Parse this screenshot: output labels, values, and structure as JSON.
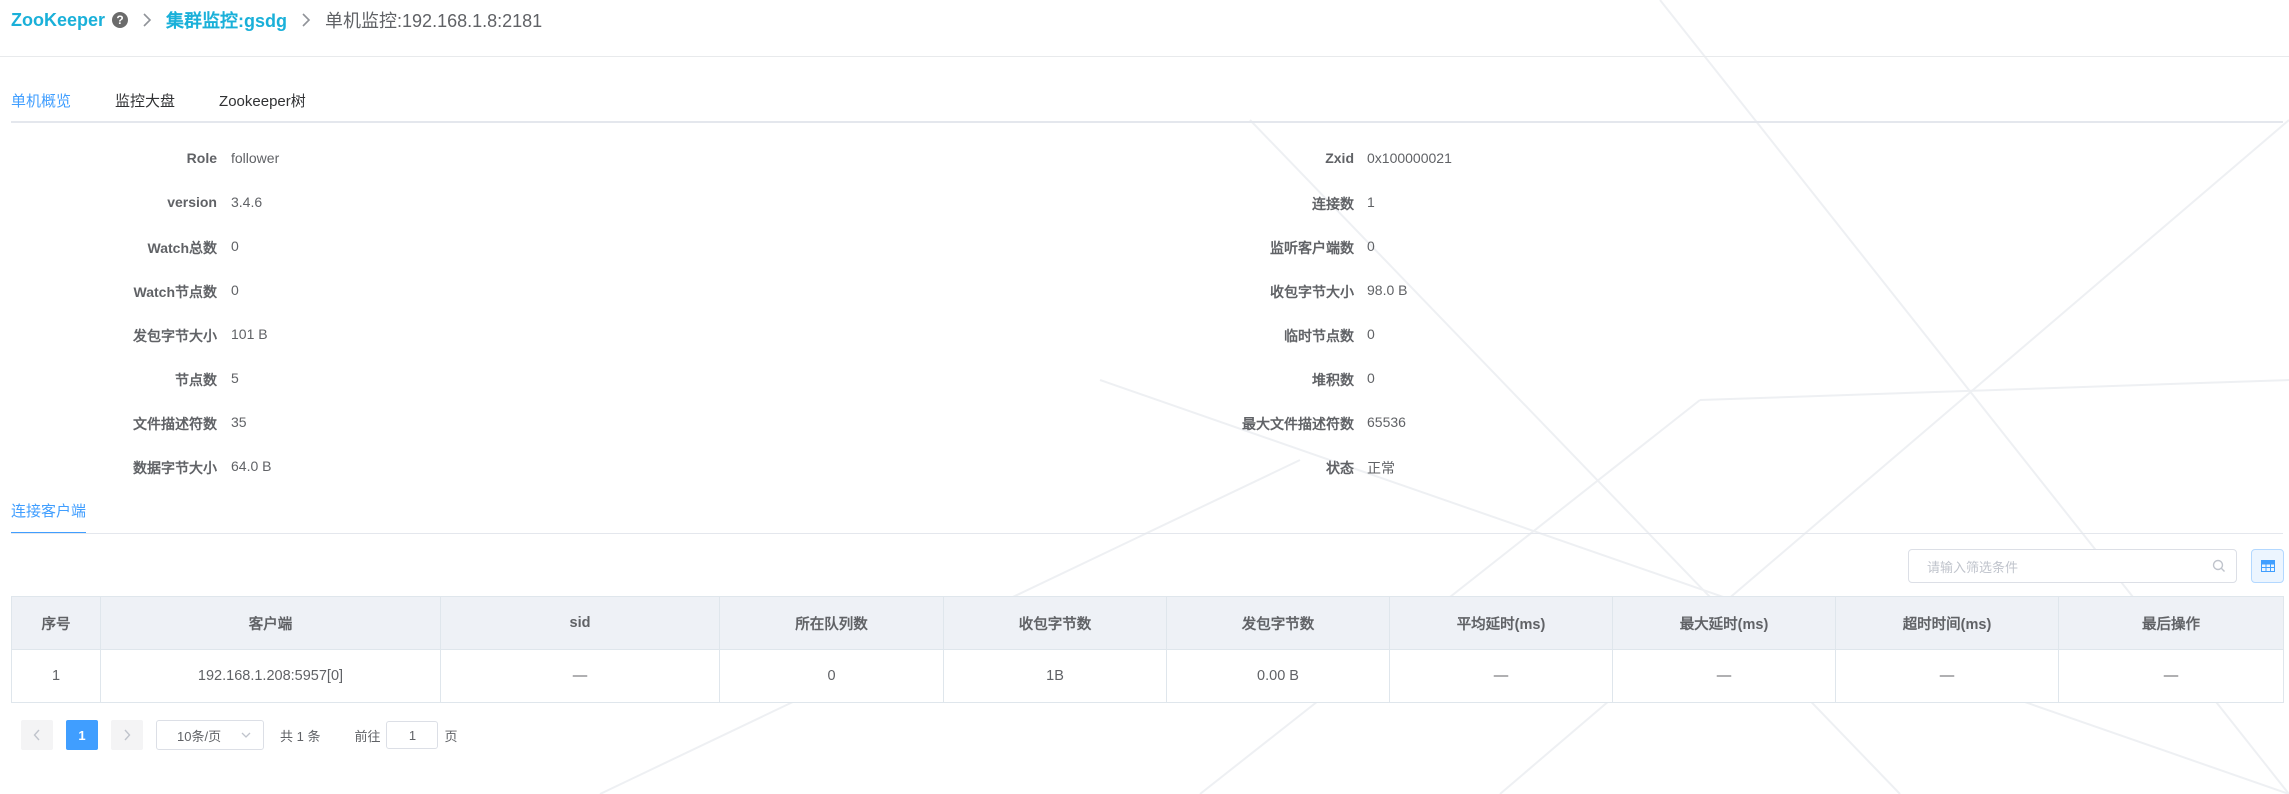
{
  "breadcrumb": {
    "root": "ZooKeeper",
    "help_glyph": "?",
    "cluster": "集群监控:gsdg",
    "current": "单机监控:192.168.1.8:2181"
  },
  "tabs": [
    "单机概览",
    "监控大盘",
    "Zookeeper树"
  ],
  "overview": {
    "left": [
      {
        "label": "Role",
        "value": "follower"
      },
      {
        "label": "version",
        "value": "3.4.6"
      },
      {
        "label": "Watch总数",
        "value": "0"
      },
      {
        "label": "Watch节点数",
        "value": "0"
      },
      {
        "label": "发包字节大小",
        "value": "101 B"
      },
      {
        "label": "节点数",
        "value": "5"
      },
      {
        "label": "文件描述符数",
        "value": "35"
      },
      {
        "label": "数据字节大小",
        "value": "64.0 B"
      }
    ],
    "right": [
      {
        "label": "Zxid",
        "value": "0x100000021"
      },
      {
        "label": "连接数",
        "value": "1"
      },
      {
        "label": "监听客户端数",
        "value": "0"
      },
      {
        "label": "收包字节大小",
        "value": "98.0 B"
      },
      {
        "label": "临时节点数",
        "value": "0"
      },
      {
        "label": "堆积数",
        "value": "0"
      },
      {
        "label": "最大文件描述符数",
        "value": "65536"
      },
      {
        "label": "状态",
        "value": "正常"
      }
    ]
  },
  "clients": {
    "tab_label": "连接客户端",
    "search_placeholder": "请输入筛选条件",
    "columns": [
      "序号",
      "客户端",
      "sid",
      "所在队列数",
      "收包字节数",
      "发包字节数",
      "平均延时(ms)",
      "最大延时(ms)",
      "超时时间(ms)",
      "最后操作"
    ],
    "rows": [
      [
        "1",
        "192.168.1.208:5957[0]",
        "—",
        "0",
        "1B",
        "0.00 B",
        "—",
        "—",
        "—",
        "—"
      ]
    ]
  },
  "pagination": {
    "current_page": "1",
    "page_size": "10条/页",
    "total": "共 1 条",
    "goto_prefix": "前往",
    "goto_value": "1",
    "goto_suffix": "页"
  },
  "colors": {
    "brand": "#1ab0d9",
    "accent": "#409eff"
  }
}
